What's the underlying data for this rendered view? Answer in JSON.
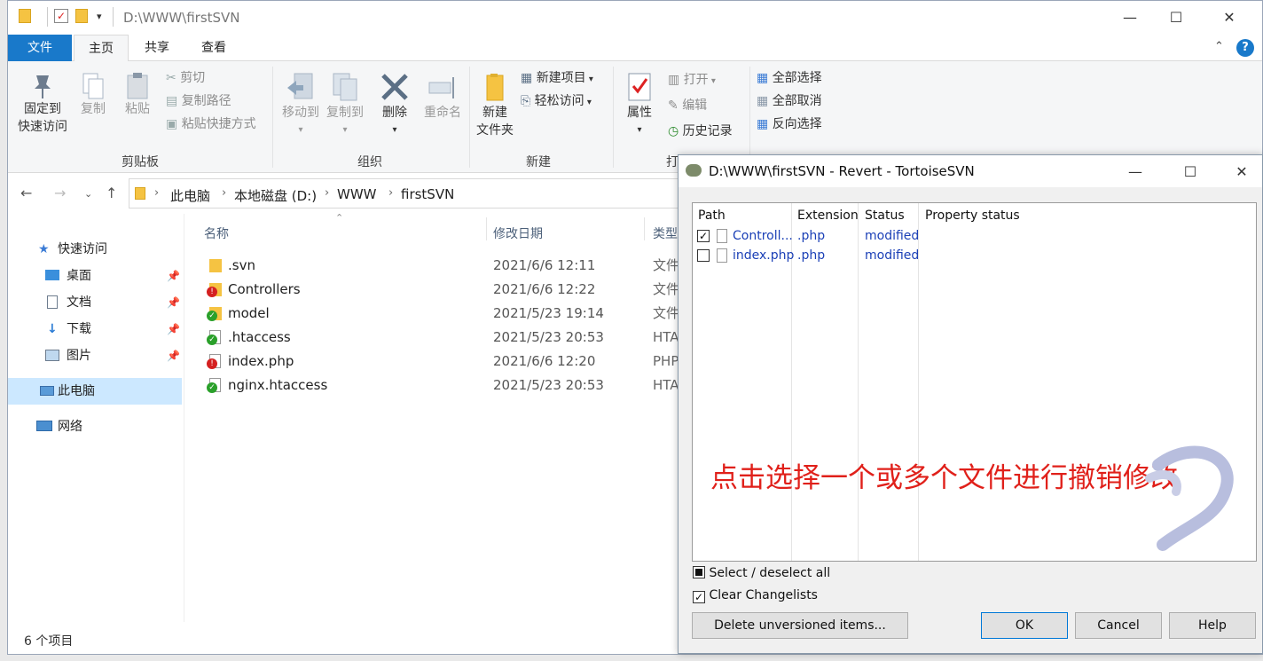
{
  "explorer": {
    "title": "D:\\WWW\\firstSVN",
    "tabs": {
      "file": "文件",
      "home": "主页",
      "share": "共享",
      "view": "查看"
    },
    "ribbon": {
      "pin": [
        "固定到",
        "快速访问"
      ],
      "copy": "复制",
      "paste": "粘贴",
      "cut": "剪切",
      "copy_path": "复制路径",
      "paste_shortcut": "粘贴快捷方式",
      "group_clipboard": "剪贴板",
      "move_to": "移动到",
      "copy_to": "复制到",
      "delete": "删除",
      "rename": "重命名",
      "group_organize": "组织",
      "new_folder": [
        "新建",
        "文件夹"
      ],
      "new_item": "新建项目",
      "easy_access": "轻松访问",
      "group_new": "新建",
      "properties": "属性",
      "open": "打开",
      "edit": "编辑",
      "history": "历史记录",
      "group_open": "打",
      "select_all": "全部选择",
      "select_none": "全部取消",
      "invert": "反向选择"
    },
    "breadcrumb": [
      "此电脑",
      "本地磁盘 (D:)",
      "WWW",
      "firstSVN"
    ],
    "nav": {
      "quick_access": "快速访问",
      "desktop": "桌面",
      "documents": "文档",
      "downloads": "下载",
      "pictures": "图片",
      "this_pc": "此电脑",
      "network": "网络"
    },
    "columns": {
      "name": "名称",
      "date": "修改日期",
      "type": "类型"
    },
    "files": [
      {
        "name": ".svn",
        "date": "2021/6/6 12:11",
        "type": "文件",
        "icon": "folder-icon"
      },
      {
        "name": "Controllers",
        "date": "2021/6/6 12:22",
        "type": "文件",
        "icon": "svn-modified-folder-icon"
      },
      {
        "name": "model",
        "date": "2021/5/23 19:14",
        "type": "文件",
        "icon": "svn-normal-folder-icon"
      },
      {
        "name": ".htaccess",
        "date": "2021/5/23 20:53",
        "type": "HTA",
        "icon": "svn-normal-file-icon"
      },
      {
        "name": "index.php",
        "date": "2021/6/6 12:20",
        "type": "PHP",
        "icon": "svn-modified-file-icon"
      },
      {
        "name": "nginx.htaccess",
        "date": "2021/5/23 20:53",
        "type": "HTA",
        "icon": "svn-normal-file-icon"
      }
    ],
    "status": "6 个项目"
  },
  "dialog": {
    "title": "D:\\WWW\\firstSVN - Revert - TortoiseSVN",
    "columns": {
      "path": "Path",
      "extension": "Extension",
      "status": "Status",
      "property_status": "Property status"
    },
    "rows": [
      {
        "path": "Controll...",
        "ext": ".php",
        "status": "modified",
        "checked": true
      },
      {
        "path": "index.php",
        "ext": ".php",
        "status": "modified",
        "checked": false
      }
    ],
    "annotation": "点击选择一个或多个文件进行撤销修改",
    "select_all": "Select / deselect all",
    "clear_changelists": "Clear Changelists",
    "delete_unversioned": "Delete unversioned items...",
    "ok": "OK",
    "cancel": "Cancel",
    "help": "Help"
  },
  "colors": {
    "accent": "#1979ca",
    "selection": "#cce8ff",
    "annotation": "#e0201a",
    "svn_link": "#1a3fb6"
  }
}
